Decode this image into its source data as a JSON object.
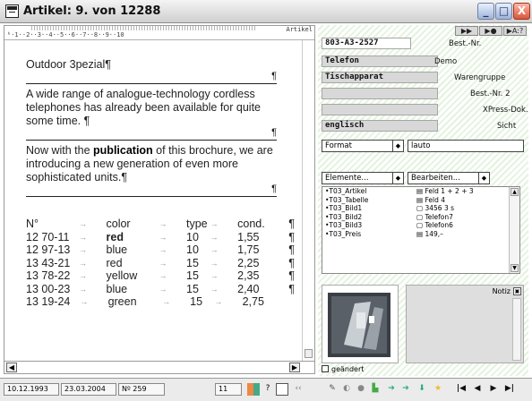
{
  "window": {
    "title": "Artikel: 9. von 12288",
    "buttons": {
      "minimize": "_",
      "maximize": "□",
      "close": "X"
    }
  },
  "ruler": {
    "ticks": "ᵇ·1··2··3··4··5··6··7··8··9··10",
    "field_tag": "Artikel"
  },
  "document": {
    "heading": "Outdoor 3pezial",
    "para_mark": "¶",
    "para1": "A wide range of analogue-technology cordless telephones has already been available for quite some time.",
    "para2_before": "Now with the ",
    "para2_bold": "publication",
    "para2_after": " of this brochure, we are introducing a new generation of even more sophisticated units.",
    "table": {
      "headers": [
        "N°",
        "color",
        "type",
        "cond."
      ],
      "arrow": "→",
      "rows": [
        [
          "12 70-11",
          "red",
          "10",
          "1,55"
        ],
        [
          "12 97-13",
          "blue",
          "10",
          "1,75"
        ],
        [
          "13 43-21",
          "red",
          "15",
          "2,25"
        ],
        [
          "13 78-22",
          "yellow",
          "15",
          "2,35"
        ],
        [
          "13 00-23",
          "blue",
          "15",
          "2,40"
        ],
        [
          "13 19-24",
          "green",
          "15",
          "2,75"
        ]
      ]
    }
  },
  "right": {
    "toolicons": [
      "▶▶",
      "▶●",
      "▶A:?"
    ],
    "fields": [
      {
        "value": "803-A3-2527",
        "label": "Best.-Nr."
      },
      {
        "value": "Telefon",
        "label": "Demo"
      },
      {
        "value": "Tischapparat",
        "label": "Warengruppe"
      },
      {
        "value": "",
        "label": "Best.-Nr. 2"
      },
      {
        "value": "",
        "label": "XPress-Dok."
      },
      {
        "value": "englisch",
        "label": "Sicht"
      }
    ],
    "format_select": "Format",
    "format_value": "lauto",
    "elemente_select": "Elemente...",
    "bearbeiten_select": "Bearbeiten...",
    "list": [
      {
        "name": "•T03_Artikel",
        "value": "▤ Feld 1 + 2 + 3"
      },
      {
        "name": "•T03_Tabelle",
        "value": "▤ Feld 4"
      },
      {
        "name": "•T03_Bild1",
        "value": "▢ 3456 3 s"
      },
      {
        "name": "•T03_Bild2",
        "value": "▢ Telefon7"
      },
      {
        "name": "•T03_Bild3",
        "value": "▢ Telefon6"
      },
      {
        "name": "•T03_Preis",
        "value": "▤ 149,–"
      }
    ],
    "notiz_label": "Notiz",
    "geandert_label": "geändert"
  },
  "status": {
    "date1": "10.12.1993",
    "date2": "23.03.2004",
    "number": "Nº 259",
    "page": "11",
    "nav": [
      "|◀",
      "◀",
      "▶",
      "▶|"
    ]
  }
}
